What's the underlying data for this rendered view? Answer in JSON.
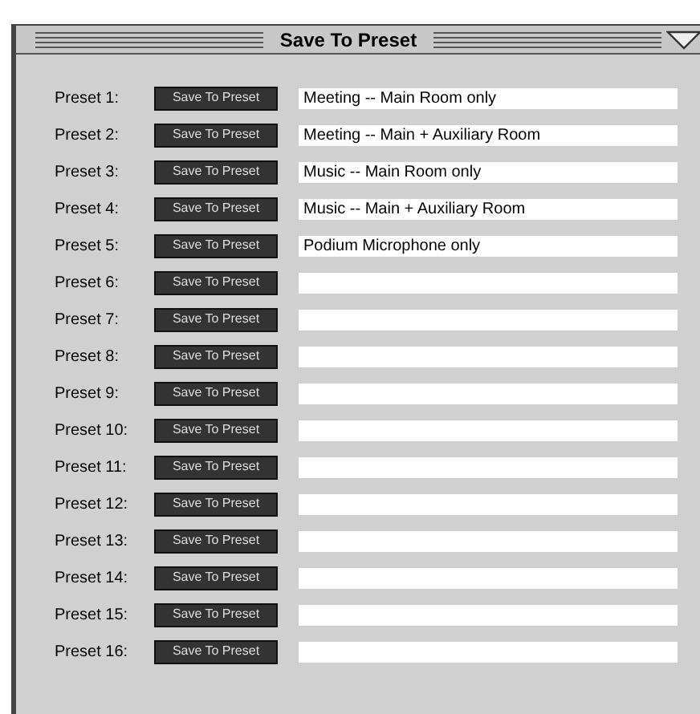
{
  "window": {
    "title": "Save To Preset"
  },
  "presets": [
    {
      "label": "Preset 1:",
      "button": "Save To Preset",
      "value": "Meeting -- Main Room only"
    },
    {
      "label": "Preset 2:",
      "button": "Save To Preset",
      "value": "Meeting -- Main + Auxiliary Room"
    },
    {
      "label": "Preset 3:",
      "button": "Save To Preset",
      "value": "Music -- Main Room only"
    },
    {
      "label": "Preset 4:",
      "button": "Save To Preset",
      "value": "Music -- Main + Auxiliary Room"
    },
    {
      "label": "Preset 5:",
      "button": "Save To Preset",
      "value": "Podium Microphone only"
    },
    {
      "label": "Preset 6:",
      "button": "Save To Preset"
    },
    {
      "label": "Preset 7:",
      "button": "Save To Preset"
    },
    {
      "label": "Preset 8:",
      "button": "Save To Preset"
    },
    {
      "label": "Preset 9:",
      "button": "Save To Preset"
    },
    {
      "label": "Preset 10:",
      "button": "Save To Preset"
    },
    {
      "label": "Preset 11:",
      "button": "Save To Preset"
    },
    {
      "label": "Preset 12:",
      "button": "Save To Preset"
    },
    {
      "label": "Preset 13:",
      "button": "Save To Preset"
    },
    {
      "label": "Preset 14:",
      "button": "Save To Preset"
    },
    {
      "label": "Preset 15:",
      "button": "Save To Preset"
    },
    {
      "label": "Preset 16:",
      "button": "Save To Preset"
    }
  ]
}
